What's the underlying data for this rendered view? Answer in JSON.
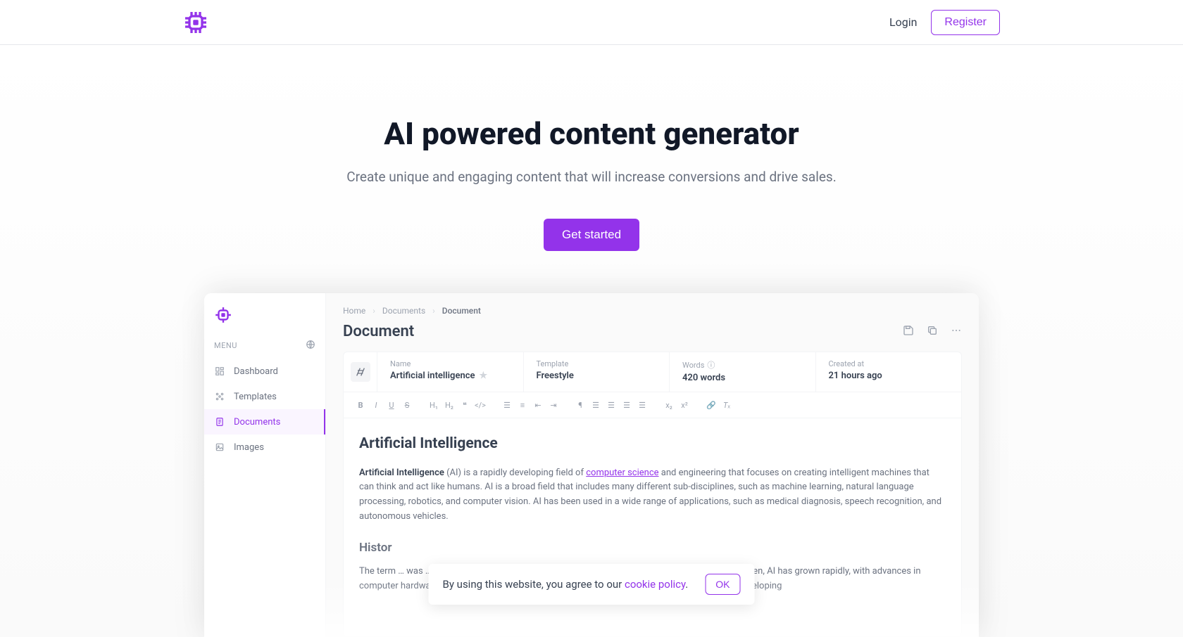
{
  "header": {
    "login": "Login",
    "register": "Register"
  },
  "hero": {
    "title": "AI powered content generator",
    "subtitle": "Create unique and engaging content that will increase conversions and drive sales.",
    "cta": "Get started"
  },
  "sidebar": {
    "menu_label": "MENU",
    "items": [
      {
        "label": "Dashboard"
      },
      {
        "label": "Templates"
      },
      {
        "label": "Documents"
      },
      {
        "label": "Images"
      }
    ]
  },
  "breadcrumb": {
    "home": "Home",
    "docs": "Documents",
    "current": "Document"
  },
  "doc": {
    "title": "Document",
    "meta": {
      "name_label": "Name",
      "name_value": "Artificial intelligence",
      "template_label": "Template",
      "template_value": "Freestyle",
      "words_label": "Words",
      "words_value": "420 words",
      "created_label": "Created at",
      "created_value": "21 hours ago"
    },
    "article": {
      "h1": "Artificial Intelligence",
      "p1_bold": "Artificial Intelligence",
      "p1_a": " (AI) is a rapidly developing field of ",
      "p1_link": "computer science",
      "p1_b": " and engineering that focuses on creating intelligent machines that can think and act like humans. AI is a broad field that includes many different sub-disciplines, such as machine learning, natural language processing, robotics, and computer vision. AI has been used in a wide range of applications, such as medical diagnosis, speech recognition, and autonomous vehicles.",
      "h2": "Histor",
      "p2": "The term … was … in 1956 by John McCarthy, a computer scientist at Dartmouth College. Since then, AI has grown rapidly, with advances in computer hardware, software, and algorithms. In the early days of AI, researchers focused on developing"
    }
  },
  "cookie": {
    "text_a": "By using this website, you agree to our ",
    "link": "cookie policy",
    "text_b": ".",
    "ok": "OK"
  }
}
